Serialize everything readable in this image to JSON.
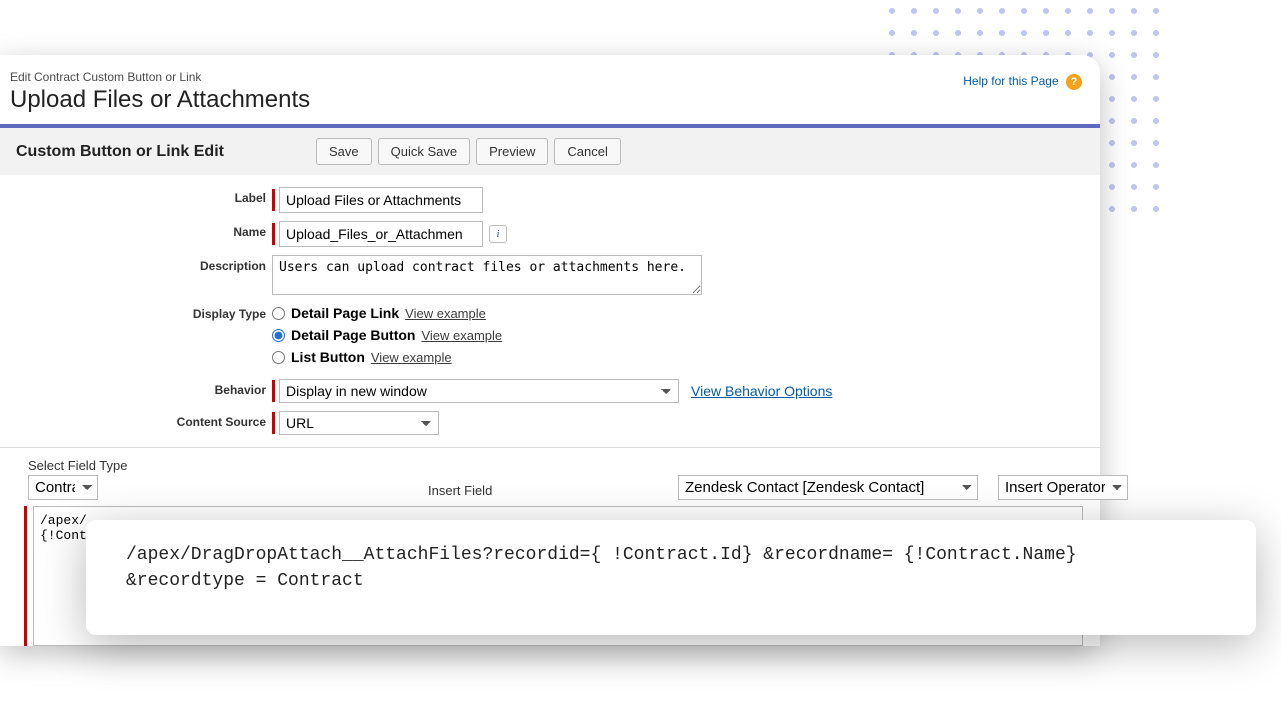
{
  "page": {
    "breadcrumb": "Edit Contract Custom Button or Link",
    "title": "Upload Files or Attachments",
    "help_label": "Help for this Page"
  },
  "section": {
    "title": "Custom Button or Link Edit"
  },
  "buttons": {
    "save": "Save",
    "quick_save": "Quick Save",
    "preview": "Preview",
    "cancel": "Cancel"
  },
  "fields": {
    "label": {
      "lbl": "Label",
      "value": "Upload Files or Attachments"
    },
    "name": {
      "lbl": "Name",
      "value": "Upload_Files_or_Attachmen"
    },
    "description": {
      "lbl": "Description",
      "value": "Users can upload contract files or attachments here."
    },
    "display_type": {
      "lbl": "Display Type",
      "options": [
        {
          "label": "Detail Page Link",
          "example": "View example"
        },
        {
          "label": "Detail Page Button",
          "example": "View example"
        },
        {
          "label": "List Button",
          "example": "View example"
        }
      ],
      "selected_index": 1
    },
    "behavior": {
      "lbl": "Behavior",
      "value": "Display in new window",
      "link": "View Behavior Options"
    },
    "content_source": {
      "lbl": "Content Source",
      "value": "URL"
    }
  },
  "editor": {
    "select_field_type_label": "Select Field Type",
    "select_field_type_value": "Contra",
    "insert_field_label": "Insert Field",
    "merge_picker_value": "Zendesk Contact [Zendesk  Contact]",
    "insert_operator_value": "Insert Operator",
    "code_preview": "/apex/\n{!Cont"
  },
  "overlay": {
    "code": "/apex/DragDropAttach__AttachFiles?recordid={ !Contract.Id} &recordname= {!Contract.Name}\n&recordtype = Contract"
  }
}
